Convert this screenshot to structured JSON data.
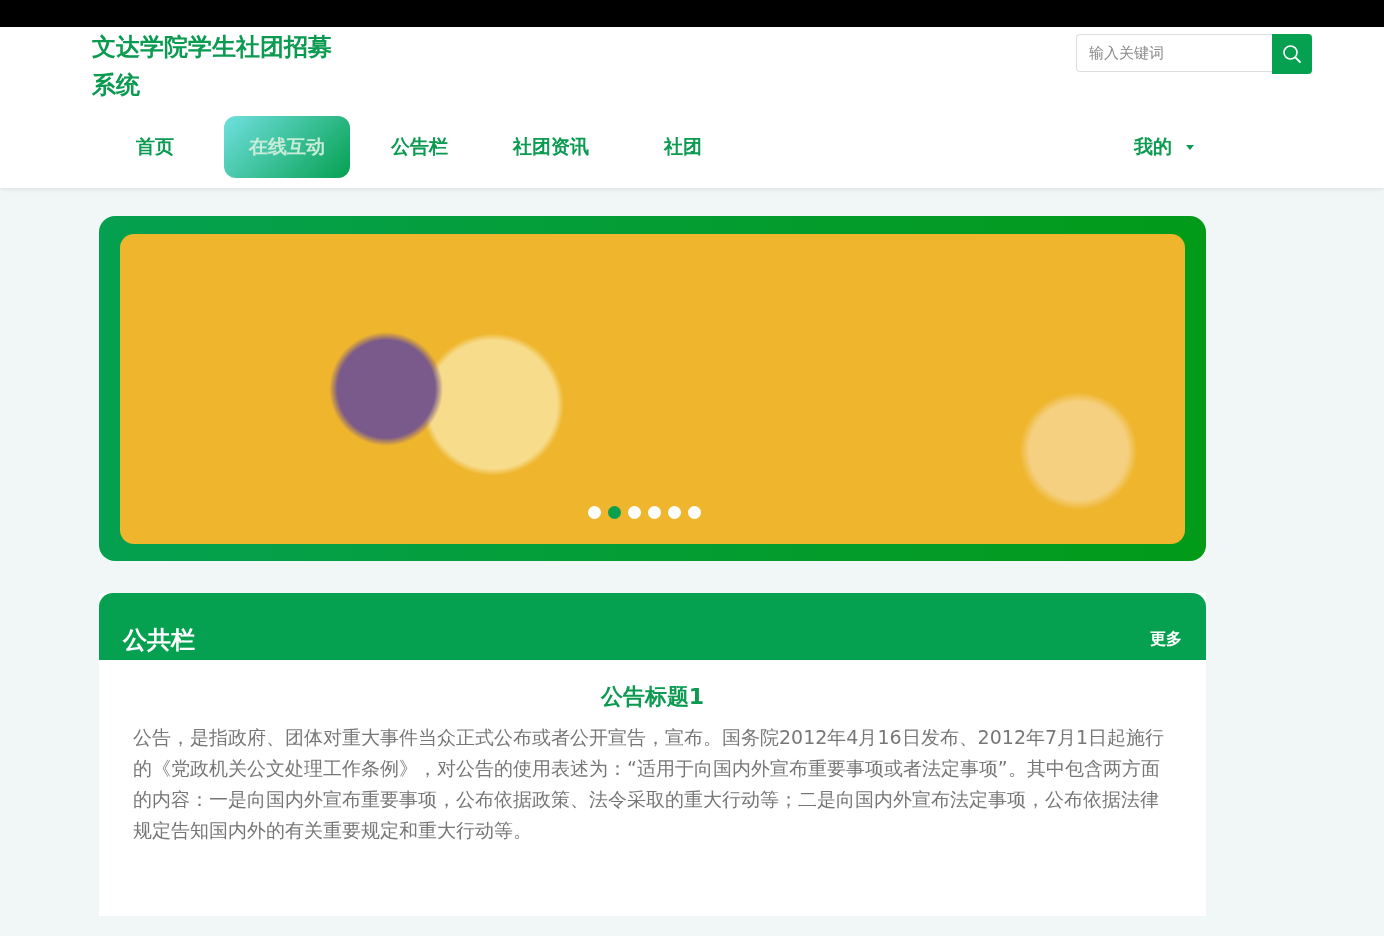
{
  "site_title": "文达学院学生社团招募系统",
  "nav": [
    {
      "label": "首页",
      "selected": false
    },
    {
      "label": "在线互动",
      "selected": true
    },
    {
      "label": "公告栏",
      "selected": false
    },
    {
      "label": "社团资讯",
      "selected": false
    },
    {
      "label": "社团",
      "selected": false
    }
  ],
  "search": {
    "placeholder": "输入关键词"
  },
  "user_menu": {
    "label": "我的"
  },
  "carousel": {
    "dots": [
      {
        "selected": false
      },
      {
        "selected": true
      },
      {
        "selected": false
      },
      {
        "selected": false
      },
      {
        "selected": false
      },
      {
        "selected": false
      }
    ]
  },
  "notice_panel": {
    "title": "公共栏",
    "more": "更多",
    "item_title": "公告标题1",
    "item_body": "公告，是指政府、团体对重大事件当众正式公布或者公开宣告，宣布。国务院2012年4月16日发布、2012年7月1日起施行的《党政机关公文处理工作条例》，对公告的使用表述为：“适用于向国内外宣布重要事项或者法定事项”。其中包含两方面的内容：一是向国内外宣布重要事项，公布依据政策、法令采取的重大行动等；二是向国内外宣布法定事项，公布依据法律规定告知国内外的有关重要规定和重大行动等。"
  }
}
